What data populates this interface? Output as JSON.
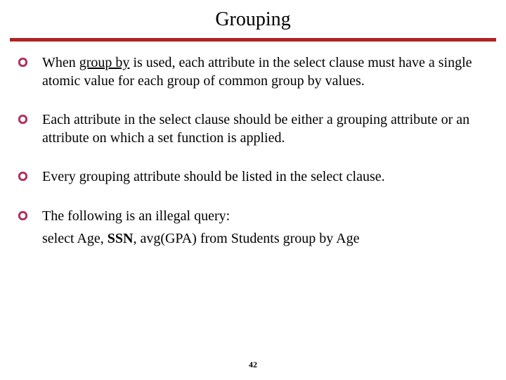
{
  "title": "Grouping",
  "page_number": "42",
  "bullet_color": "#b03060",
  "bullets": [
    {
      "parts": [
        {
          "t": "When "
        },
        {
          "t": "group by",
          "u": true
        },
        {
          "t": " is used, each attribute in the select clause must have a single atomic value for each group of common group by values."
        }
      ]
    },
    {
      "parts": [
        {
          "t": "Each attribute in the select clause should be either a grouping attribute or an attribute on which a set function is applied."
        }
      ]
    },
    {
      "parts": [
        {
          "t": "Every grouping attribute should be listed in the select clause."
        }
      ]
    },
    {
      "parts": [
        {
          "t": "The following is an illegal query:"
        }
      ],
      "query_parts": [
        {
          "t": "select Age, "
        },
        {
          "t": "SSN",
          "b": true
        },
        {
          "t": ", avg(GPA) from Students group by Age"
        }
      ]
    }
  ]
}
